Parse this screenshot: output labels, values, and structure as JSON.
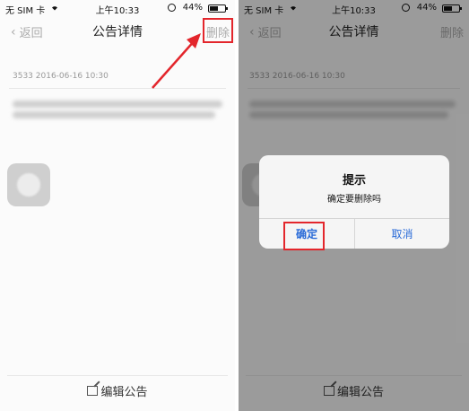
{
  "status_bar": {
    "carrier": "无 SIM 卡",
    "time": "上午10:33",
    "battery": "44%"
  },
  "navbar": {
    "back_label": "返回",
    "title": "公告详情",
    "delete_label": "删除"
  },
  "announcement": {
    "meta": "3533 2016-06-16 10:30"
  },
  "toolbar": {
    "edit_label": "编辑公告"
  },
  "alert": {
    "title": "提示",
    "message": "确定要删除吗",
    "confirm_label": "确定",
    "cancel_label": "取消"
  },
  "colors": {
    "highlight": "#e3262c",
    "alert_button": "#2a6bd8"
  }
}
